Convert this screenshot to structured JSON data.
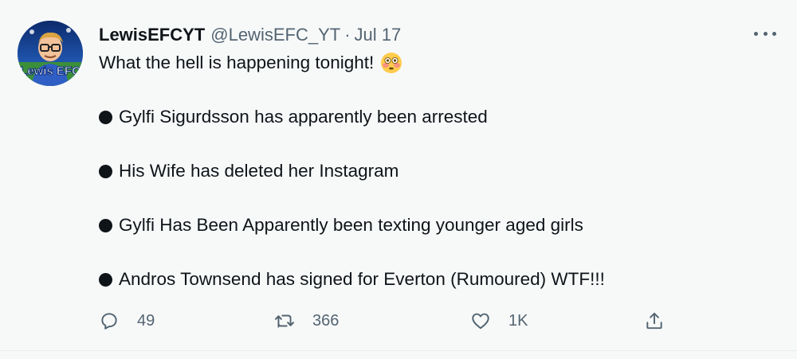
{
  "tweet": {
    "display_name": "LewisEFCYT",
    "handle": "@LewisEFC_YT",
    "separator": "·",
    "date": "Jul 17",
    "avatar_text": "Lewis EFC",
    "headline": "What the hell is happening tonight!",
    "headline_emoji": "flushed-face-emoji",
    "bullets": [
      "Gylfi Sigurdsson has apparently been arrested",
      "His Wife has deleted her Instagram",
      "Gylfi Has Been Apparently been texting younger aged girls",
      "Andros Townsend has signed for Everton (Rumoured) WTF!!!"
    ]
  },
  "actions": {
    "reply": {
      "icon": "reply-icon",
      "count": "49"
    },
    "retweet": {
      "icon": "retweet-icon",
      "count": "366"
    },
    "like": {
      "icon": "heart-icon",
      "count": "1K"
    },
    "share": {
      "icon": "share-icon"
    }
  },
  "colors": {
    "text": "#0f1419",
    "secondary": "#536471",
    "background": "#f7f9f9",
    "avatar_blue": "#1a3d8f"
  }
}
